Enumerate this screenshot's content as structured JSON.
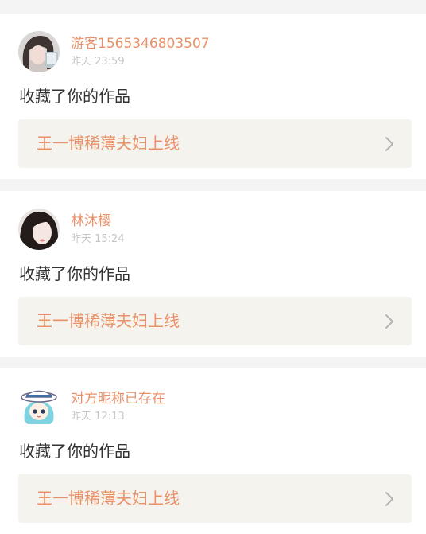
{
  "notifications": [
    {
      "username": "游客1565346803507",
      "time": "昨天 23:59",
      "action": "收藏了你的作品",
      "work_title": "王一博稀薄夫妇上线",
      "avatar_icon": "user-avatar-photo-1"
    },
    {
      "username": "林沐樱",
      "time": "昨天 15:24",
      "action": "收藏了你的作品",
      "work_title": "王一博稀薄夫妇上线",
      "avatar_icon": "user-avatar-photo-2"
    },
    {
      "username": "对方昵称已存在",
      "time": "昨天 12:13",
      "action": "收藏了你的作品",
      "work_title": "王一博稀薄夫妇上线",
      "avatar_icon": "user-avatar-cartoon"
    }
  ],
  "colors": {
    "accent": "#e9926a",
    "muted": "#c6c6c6",
    "text": "#333333",
    "work_bg": "#f4f3ee",
    "page_bg": "#f4f4f4"
  }
}
